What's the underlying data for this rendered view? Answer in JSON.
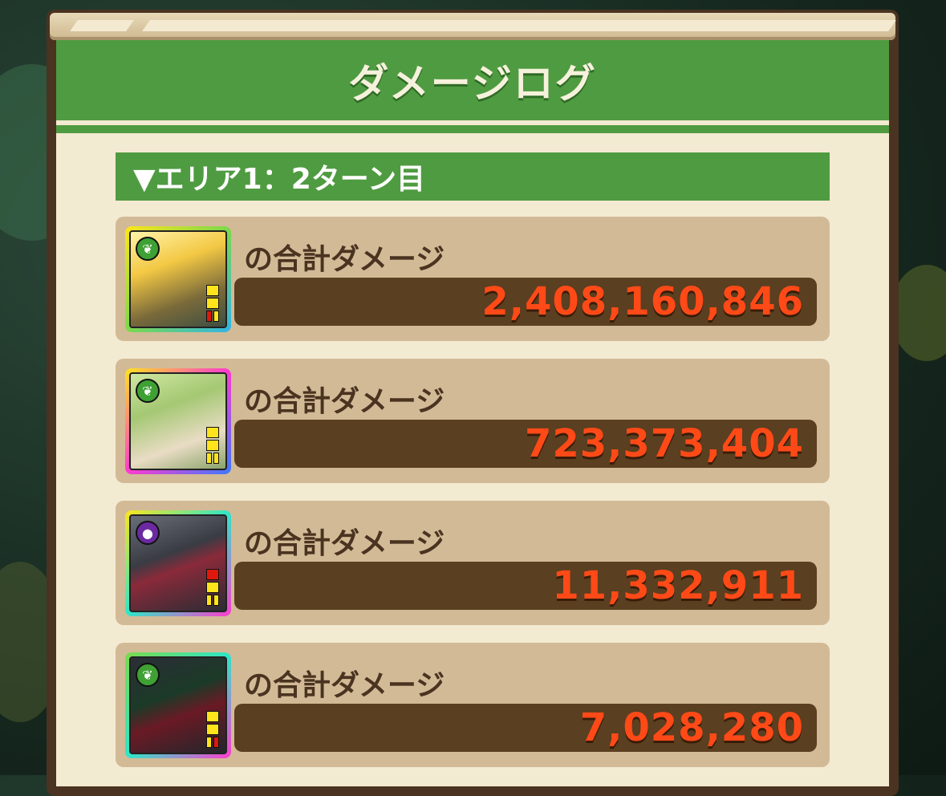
{
  "window": {
    "title": "ダメージログ"
  },
  "section": {
    "header": "▼エリア1：2ターン目"
  },
  "entries": [
    {
      "label": "の合計ダメージ",
      "value": "2,408,160,846",
      "attribute": "wood",
      "attribute_icon": "leaf-orb-icon"
    },
    {
      "label": "の合計ダメージ",
      "value": "723,373,404",
      "attribute": "wood",
      "attribute_icon": "leaf-orb-icon"
    },
    {
      "label": "の合計ダメージ",
      "value": "11,332,911",
      "attribute": "dark",
      "attribute_icon": "dark-orb-icon"
    },
    {
      "label": "の合計ダメージ",
      "value": "7,028,280",
      "attribute": "wood",
      "attribute_icon": "leaf-orb-icon"
    }
  ],
  "colors": {
    "header_green": "#4f9b41",
    "panel_bg": "#f3ead2",
    "entry_bg": "#d2ba96",
    "value_bar": "#5a3f20",
    "damage_text": "#ff4a18",
    "label_text": "#4a3320"
  }
}
